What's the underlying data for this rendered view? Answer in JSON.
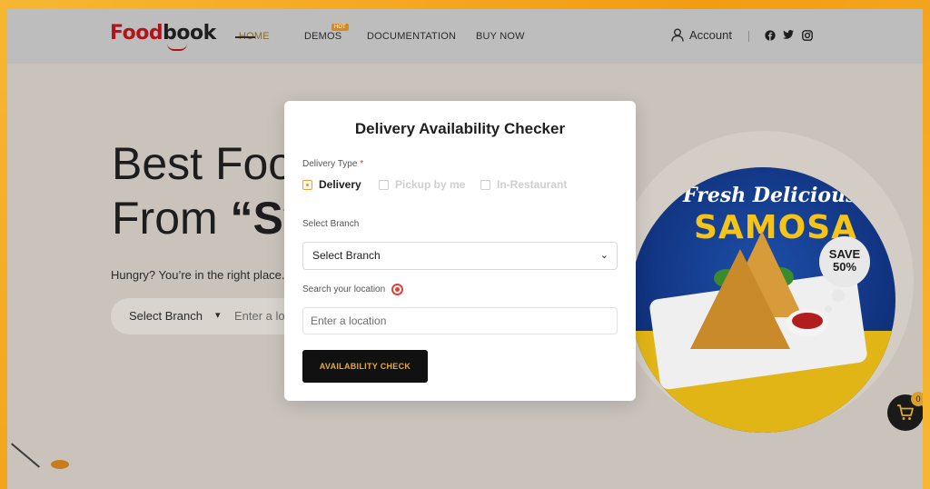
{
  "header": {
    "logo_a": "Food",
    "logo_b": "book",
    "nav": {
      "home": "HOME",
      "demos": "DEMOS",
      "hot": "HOT",
      "docs": "DOCUMENTATION",
      "buy": "BUY NOW"
    },
    "account": "Account",
    "social_icons": [
      "facebook-icon",
      "twitter-icon",
      "instagram-icon"
    ]
  },
  "hero": {
    "title_line1": "Best Foo",
    "title_line2_prefix": "From ",
    "title_line2_strong": "“Sy",
    "subtitle": "Hungry? You’re in the right place...",
    "branch_select": "Select Branch",
    "location_placeholder": "Enter a loc"
  },
  "promo": {
    "line1": "Fresh Delicious",
    "line2": "SAMOSA",
    "badge_line1": "SAVE",
    "badge_line2": "50%"
  },
  "cart": {
    "count": "0"
  },
  "modal": {
    "title": "Delivery Availability Checker",
    "delivery_type_label": "Delivery Type",
    "required_mark": "*",
    "options": [
      {
        "label": "Delivery",
        "checked": true
      },
      {
        "label": "Pickup by me",
        "checked": false
      },
      {
        "label": "In-Restaurant",
        "checked": false
      }
    ],
    "branch_label": "Select Branch",
    "branch_value": "Select Branch",
    "location_label": "Search your location",
    "location_placeholder": "Enter a location",
    "button": "AVAILABILITY CHECK"
  },
  "colors": {
    "accent": "#e3a93c",
    "brand_red": "#b0151b",
    "frame_orange": "#f5a623",
    "button_bg": "#111111"
  }
}
